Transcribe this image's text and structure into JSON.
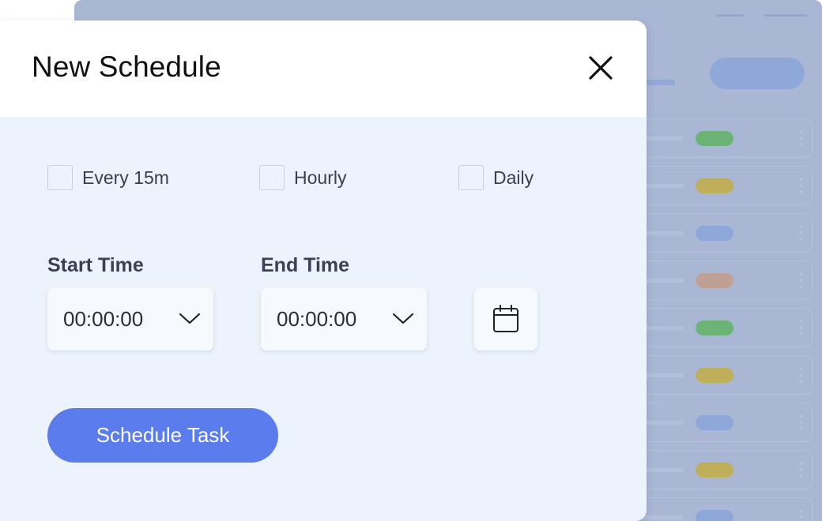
{
  "modal": {
    "title": "New Schedule",
    "options": [
      {
        "label": "Every 15m",
        "checked": false
      },
      {
        "label": "Hourly",
        "checked": false
      },
      {
        "label": "Daily",
        "checked": false
      }
    ],
    "start_time": {
      "label": "Start Time",
      "value": "00:00:00"
    },
    "end_time": {
      "label": "End Time",
      "value": "00:00:00"
    },
    "submit_label": "Schedule Task",
    "icons": {
      "close": "close-icon",
      "calendar": "calendar-icon",
      "dropdown": "chevron-down-icon"
    }
  },
  "background": {
    "status_pill_colors": [
      "#6bb476",
      "#bfae5a",
      "#8fa8da",
      "#bfa095",
      "#6bb476",
      "#bfae5a",
      "#8fa8da",
      "#bfae5a",
      "#8fa8da"
    ]
  },
  "colors": {
    "accent": "#5b7cec",
    "modal_body": "#edf3fc",
    "overlay": "#a9b7d5"
  }
}
